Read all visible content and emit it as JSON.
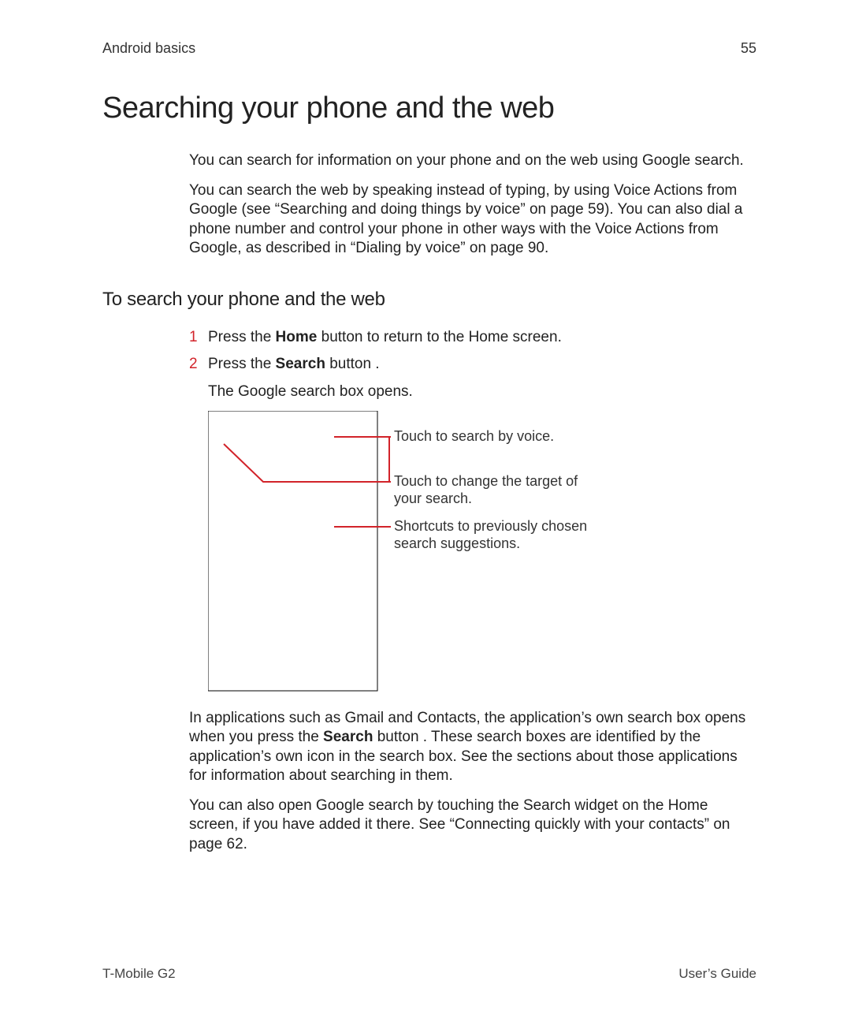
{
  "header": {
    "section": "Android basics",
    "page_number": "55"
  },
  "title": "Searching your phone and the web",
  "intro": {
    "p1": "You can search for information on your phone and on the web using Google search.",
    "p2": "You can search the web by speaking instead of typing, by using Voice Actions from Google (see “Searching and doing things by voice” on page 59). You can also dial a phone number and control your phone in other ways with the Voice Actions from Google, as described in “Dialing by voice” on page 90."
  },
  "subheading": "To search your phone and the web",
  "steps": {
    "s1_num": "1",
    "s1_pre": "Press the ",
    "s1_bold": "Home",
    "s1_post": " button       to return to the Home screen.",
    "s2_num": "2",
    "s2_pre": "Press the ",
    "s2_bold": "Search",
    "s2_post": " button      .",
    "s2_sub": "The Google search box opens."
  },
  "callouts": {
    "c1": "Touch to search by voice.",
    "c2a": "Touch to change the target of",
    "c2b": "your search.",
    "c3a": "Shortcuts to previously chosen",
    "c3b": "search suggestions."
  },
  "after": {
    "p1_pre": "In applications such as Gmail and Contacts, the application’s own search box opens when you press the ",
    "p1_bold": "Search",
    "p1_post": " button      . These search boxes are identified by the application’s own icon in the search box. See the sections about those applications for information about searching in them.",
    "p2": "You can also open Google search by touching the Search widget on the Home screen, if you have added it there. See “Connecting quickly with your contacts” on page 62."
  },
  "footer": {
    "left": "T-Mobile G2",
    "right": "User’s Guide"
  }
}
